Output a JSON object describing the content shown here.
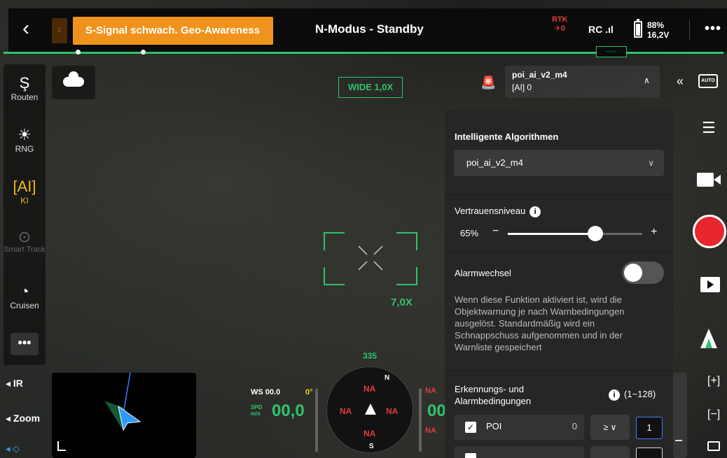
{
  "topbar": {
    "back_icon": "chevron-left-icon",
    "small_indicator": "2",
    "warning": "S-Signal schwach. Geo-Awareness",
    "mode": "N-Modus - Standby",
    "rtk_label": "RTK",
    "rtk_value": "0",
    "rc_label": "RC",
    "battery_percent": "88%",
    "battery_voltage": "16,2V",
    "more": "•••"
  },
  "left_bar": {
    "items": [
      {
        "label": "Routen",
        "icon": "route-icon"
      },
      {
        "label": "RNG",
        "icon": "rng-icon"
      },
      {
        "label": "KI",
        "icon": "ai-icon"
      },
      {
        "label": "Smart Track",
        "icon": "smart-track-icon"
      },
      {
        "label": "Cruisen",
        "icon": "speedometer-icon"
      }
    ],
    "more": "•••"
  },
  "camera": {
    "wide_label": "WIDE 1,0X",
    "zoom_label": "7,0X"
  },
  "bottom_left": {
    "ir": "IR",
    "zoom": "Zoom"
  },
  "telemetry": {
    "ws": "WS 00.0",
    "ws_angle": "0°",
    "spd_unit_1": "SPD",
    "spd_unit_2": "m/s",
    "speed": "00,0",
    "alt": "00",
    "heading": "335",
    "na": "NA",
    "compass_na": "NA",
    "compass_n": "N",
    "compass_s": "S"
  },
  "algo_head": {
    "name": "poi_ai_v2_m4",
    "count_prefix": "AI",
    "count": "0"
  },
  "panel": {
    "title": "Intelligente Algorithmen",
    "selected_algo": "poi_ai_v2_m4",
    "confidence_label": "Vertrauensniveau",
    "confidence_value": "65%",
    "confidence_fraction": 0.65,
    "alarm_label": "Alarmwechsel",
    "alarm_on": false,
    "description": "Wenn diese Funktion aktiviert ist, wird die Objektwarnung je nach Warnbedingungen ausgelöst. Standardmäßig wird ein Schnappschuss aufgenommen und in der Warnliste gespeichert",
    "conditions_label": "Erkennungs- und Alarmbedingungen",
    "conditions_range": "(1~128)",
    "row": {
      "label": "POI",
      "count": "0",
      "operator": "≥ ∨",
      "threshold": "1"
    }
  },
  "right_bar": {
    "collapse": "«",
    "auto": "AUTO",
    "zoom_in": "[+]",
    "zoom_out": "[−]"
  },
  "colors": {
    "accent_green": "#2ec36c",
    "warning_orange": "#f0931e",
    "record_red": "#e8262b",
    "alert_red": "#e23b3b"
  }
}
